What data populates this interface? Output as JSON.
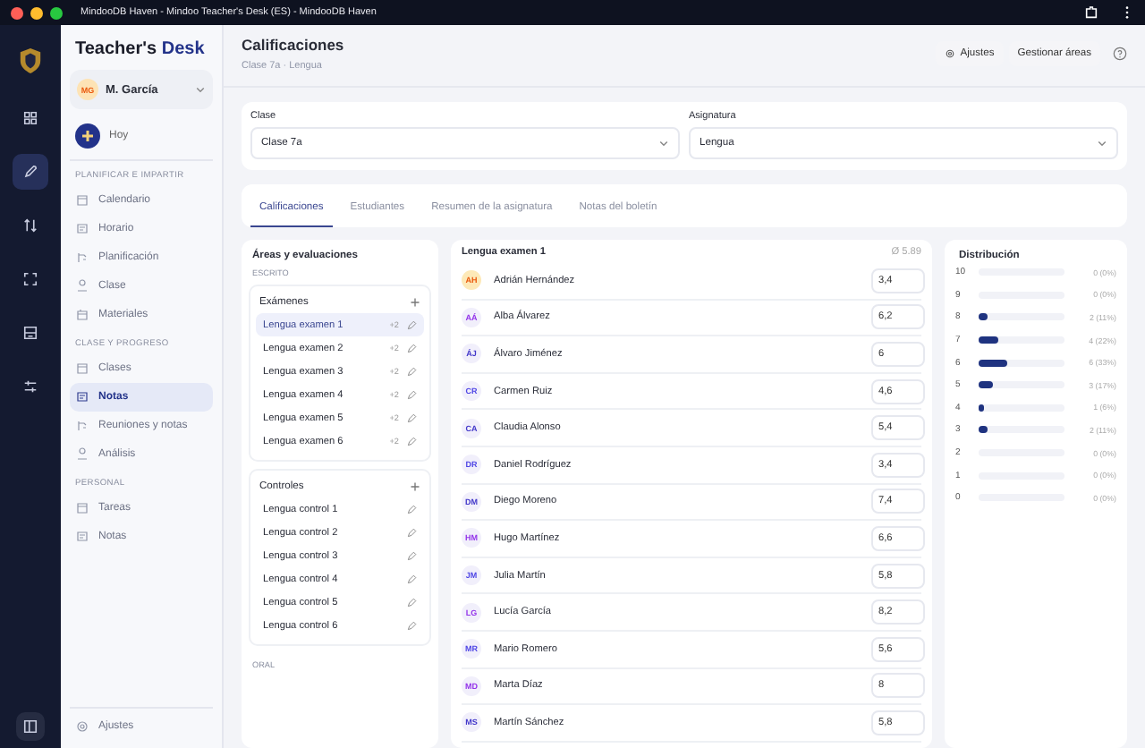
{
  "window": {
    "title": "MindooDB Haven - Mindoo Teacher's Desk (ES) - MindooDB Haven"
  },
  "rail": {
    "items": [
      {
        "selected": false
      },
      {
        "selected": true
      },
      {
        "selected": false
      },
      {
        "selected": false
      },
      {
        "selected": false
      },
      {
        "selected": false
      }
    ]
  },
  "sidebar": {
    "brand_main": "Teacher's",
    "brand_accent": "Desk",
    "user": {
      "initials": "MG",
      "name": "M. García"
    },
    "today": "Hoy",
    "sections": [
      {
        "title": "PLANIFICAR E IMPARTIR",
        "items": [
          {
            "label": "Calendario",
            "selected": false
          },
          {
            "label": "Horario",
            "selected": false
          },
          {
            "label": "Planificación",
            "selected": false
          },
          {
            "label": "Clase",
            "selected": false
          },
          {
            "label": "Materiales",
            "selected": false
          }
        ]
      },
      {
        "title": "CLASE Y PROGRESO",
        "items": [
          {
            "label": "Clases",
            "selected": false
          },
          {
            "label": "Notas",
            "selected": true
          },
          {
            "label": "Reuniones y notas",
            "selected": false
          },
          {
            "label": "Análisis",
            "selected": false
          }
        ]
      },
      {
        "title": "PERSONAL",
        "items": [
          {
            "label": "Tareas",
            "selected": false
          },
          {
            "label": "Notas",
            "selected": false
          }
        ]
      }
    ],
    "settings": "Ajustes"
  },
  "header": {
    "title": "Calificaciones",
    "subtitle": "Clase 7a · Lengua",
    "buttons": [
      "Ajustes",
      "Gestionar áreas"
    ]
  },
  "filters": [
    {
      "label": "Clase",
      "value": "Clase 7a"
    },
    {
      "label": "Asignatura",
      "value": "Lengua"
    }
  ],
  "tabs": [
    {
      "label": "Calificaciones",
      "selected": true
    },
    {
      "label": "Estudiantes",
      "selected": false
    },
    {
      "label": "Resumen de la asignatura",
      "selected": false
    },
    {
      "label": "Notas del boletín",
      "selected": false
    }
  ],
  "areas": {
    "title": "Áreas y evaluaciones",
    "groups": [
      {
        "title": "ESCRITO",
        "categories": [
          {
            "title": "Exámenes",
            "items": [
              {
                "label": "Lengua examen 1",
                "badge": "+2",
                "selected": true
              },
              {
                "label": "Lengua examen 2",
                "badge": "+2",
                "selected": false
              },
              {
                "label": "Lengua examen 3",
                "badge": "+2",
                "selected": false
              },
              {
                "label": "Lengua examen 4",
                "badge": "+2",
                "selected": false
              },
              {
                "label": "Lengua examen 5",
                "badge": "+2",
                "selected": false
              },
              {
                "label": "Lengua examen 6",
                "badge": "+2",
                "selected": false
              }
            ]
          },
          {
            "title": "Controles",
            "items": [
              {
                "label": "Lengua control 1",
                "selected": false
              },
              {
                "label": "Lengua control 2",
                "selected": false
              },
              {
                "label": "Lengua control 3",
                "selected": false
              },
              {
                "label": "Lengua control 4",
                "selected": false
              },
              {
                "label": "Lengua control 5",
                "selected": false
              },
              {
                "label": "Lengua control 6",
                "selected": false
              }
            ]
          }
        ]
      },
      {
        "title": "ORAL"
      }
    ]
  },
  "grades": {
    "title": "Lengua examen 1",
    "average": "Ø 5.89",
    "students": [
      {
        "initials": "AH",
        "name": "Adrián Hernández",
        "grade": "3,4",
        "color": "#ea580c"
      },
      {
        "initials": "AÁ",
        "name": "Alba Álvarez",
        "grade": "6,2",
        "color": "#9333ea"
      },
      {
        "initials": "ÁJ",
        "name": "Álvaro Jiménez",
        "grade": "6",
        "color": "#4338ca"
      },
      {
        "initials": "CR",
        "name": "Carmen Ruiz",
        "grade": "4,6",
        "color": "#4f46e5"
      },
      {
        "initials": "CA",
        "name": "Claudia Alonso",
        "grade": "5,4",
        "color": "#4338ca"
      },
      {
        "initials": "DR",
        "name": "Daniel Rodríguez",
        "grade": "3,4",
        "color": "#4f46e5"
      },
      {
        "initials": "DM",
        "name": "Diego Moreno",
        "grade": "7,4",
        "color": "#4338ca"
      },
      {
        "initials": "HM",
        "name": "Hugo Martínez",
        "grade": "6,6",
        "color": "#9333ea"
      },
      {
        "initials": "JM",
        "name": "Julia Martín",
        "grade": "5,8",
        "color": "#4f46e5"
      },
      {
        "initials": "LG",
        "name": "Lucía García",
        "grade": "8,2",
        "color": "#9333ea"
      },
      {
        "initials": "MR",
        "name": "Mario Romero",
        "grade": "5,6",
        "color": "#4f46e5"
      },
      {
        "initials": "MD",
        "name": "Marta Díaz",
        "grade": "8",
        "color": "#9333ea"
      },
      {
        "initials": "MS",
        "name": "Martín Sánchez",
        "grade": "5,8",
        "color": "#4338ca"
      }
    ]
  },
  "distribution": {
    "title": "Distribución",
    "rows": [
      {
        "grade": "10",
        "count": "0 (0%)"
      },
      {
        "grade": "9",
        "count": "0 (0%)"
      },
      {
        "grade": "8",
        "level": 0.11,
        "count": "2 (11%)"
      },
      {
        "grade": "7",
        "level": 0.22,
        "count": "4 (22%)"
      },
      {
        "grade": "6",
        "level": 0.33,
        "count": "6 (33%)"
      },
      {
        "grade": "5",
        "level": 0.17,
        "count": "3 (17%)"
      },
      {
        "grade": "4",
        "level": 0.06,
        "count": "1 (6%)"
      },
      {
        "grade": "3",
        "level": 0.11,
        "count": "2 (11%)"
      },
      {
        "grade": "2",
        "count": "0 (0%)"
      },
      {
        "grade": "1",
        "count": "0 (0%)"
      },
      {
        "grade": "0",
        "count": "0 (0%)"
      }
    ]
  }
}
